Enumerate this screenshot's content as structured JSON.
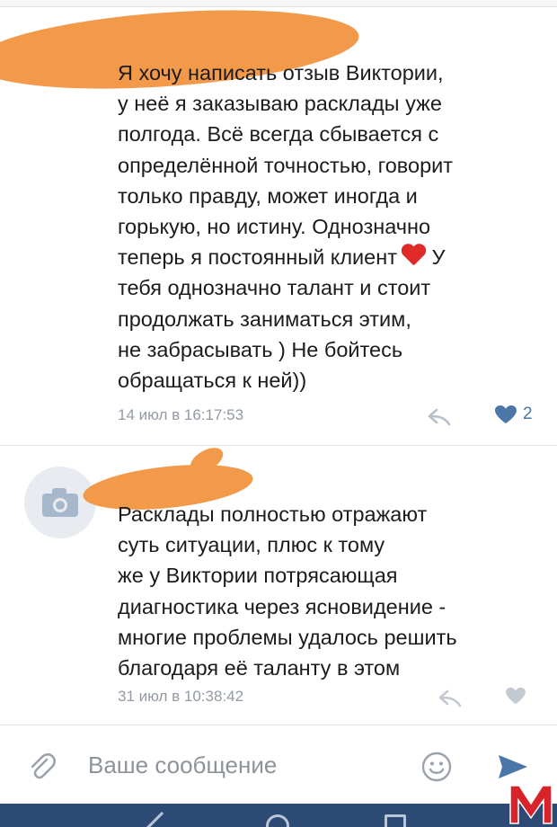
{
  "comments": [
    {
      "lines": [
        "Я хочу написать отзыв Виктории,",
        "у неё я заказываю расклады уже",
        "полгода. Всё всегда сбывается с",
        "определённой точностью, говорит",
        "только правду, может иногда и",
        "горькую, но истину. Однозначно",
        "теперь я постоянный клиент",
        "тебя однозначно талант и стоит",
        "продолжать заниматься этим,",
        "не забрасывать ) Не бойтесь",
        "обращаться к ней))"
      ],
      "line7_after_emoji": "У",
      "timestamp": "14 июл в 16:17:53",
      "likes": "2",
      "liked": true
    },
    {
      "lines": [
        "Расклады полностью отражают",
        "суть ситуации, плюс к тому",
        "же у Виктории потрясающая",
        "диагностика через ясновидение -",
        "многие проблемы удалось решить",
        "благодаря её таланту в этом"
      ],
      "timestamp": "31 июл в 10:38:42"
    }
  ],
  "composer": {
    "placeholder": "Ваше сообщение"
  },
  "icons": {
    "reply": "reply-arrow-icon",
    "like": "heart-icon",
    "avatar": "camera-icon",
    "attach": "paperclip-icon",
    "emoji": "smiley-icon",
    "send": "send-arrow-icon",
    "emoji_in_text": "red-heart-emoji"
  },
  "colors": {
    "accent": "#4a76a8",
    "meta_text": "#939aa3",
    "redaction": "#f2994a",
    "navbar": "#2c4a74",
    "heart_emoji": "#e02a2a"
  }
}
